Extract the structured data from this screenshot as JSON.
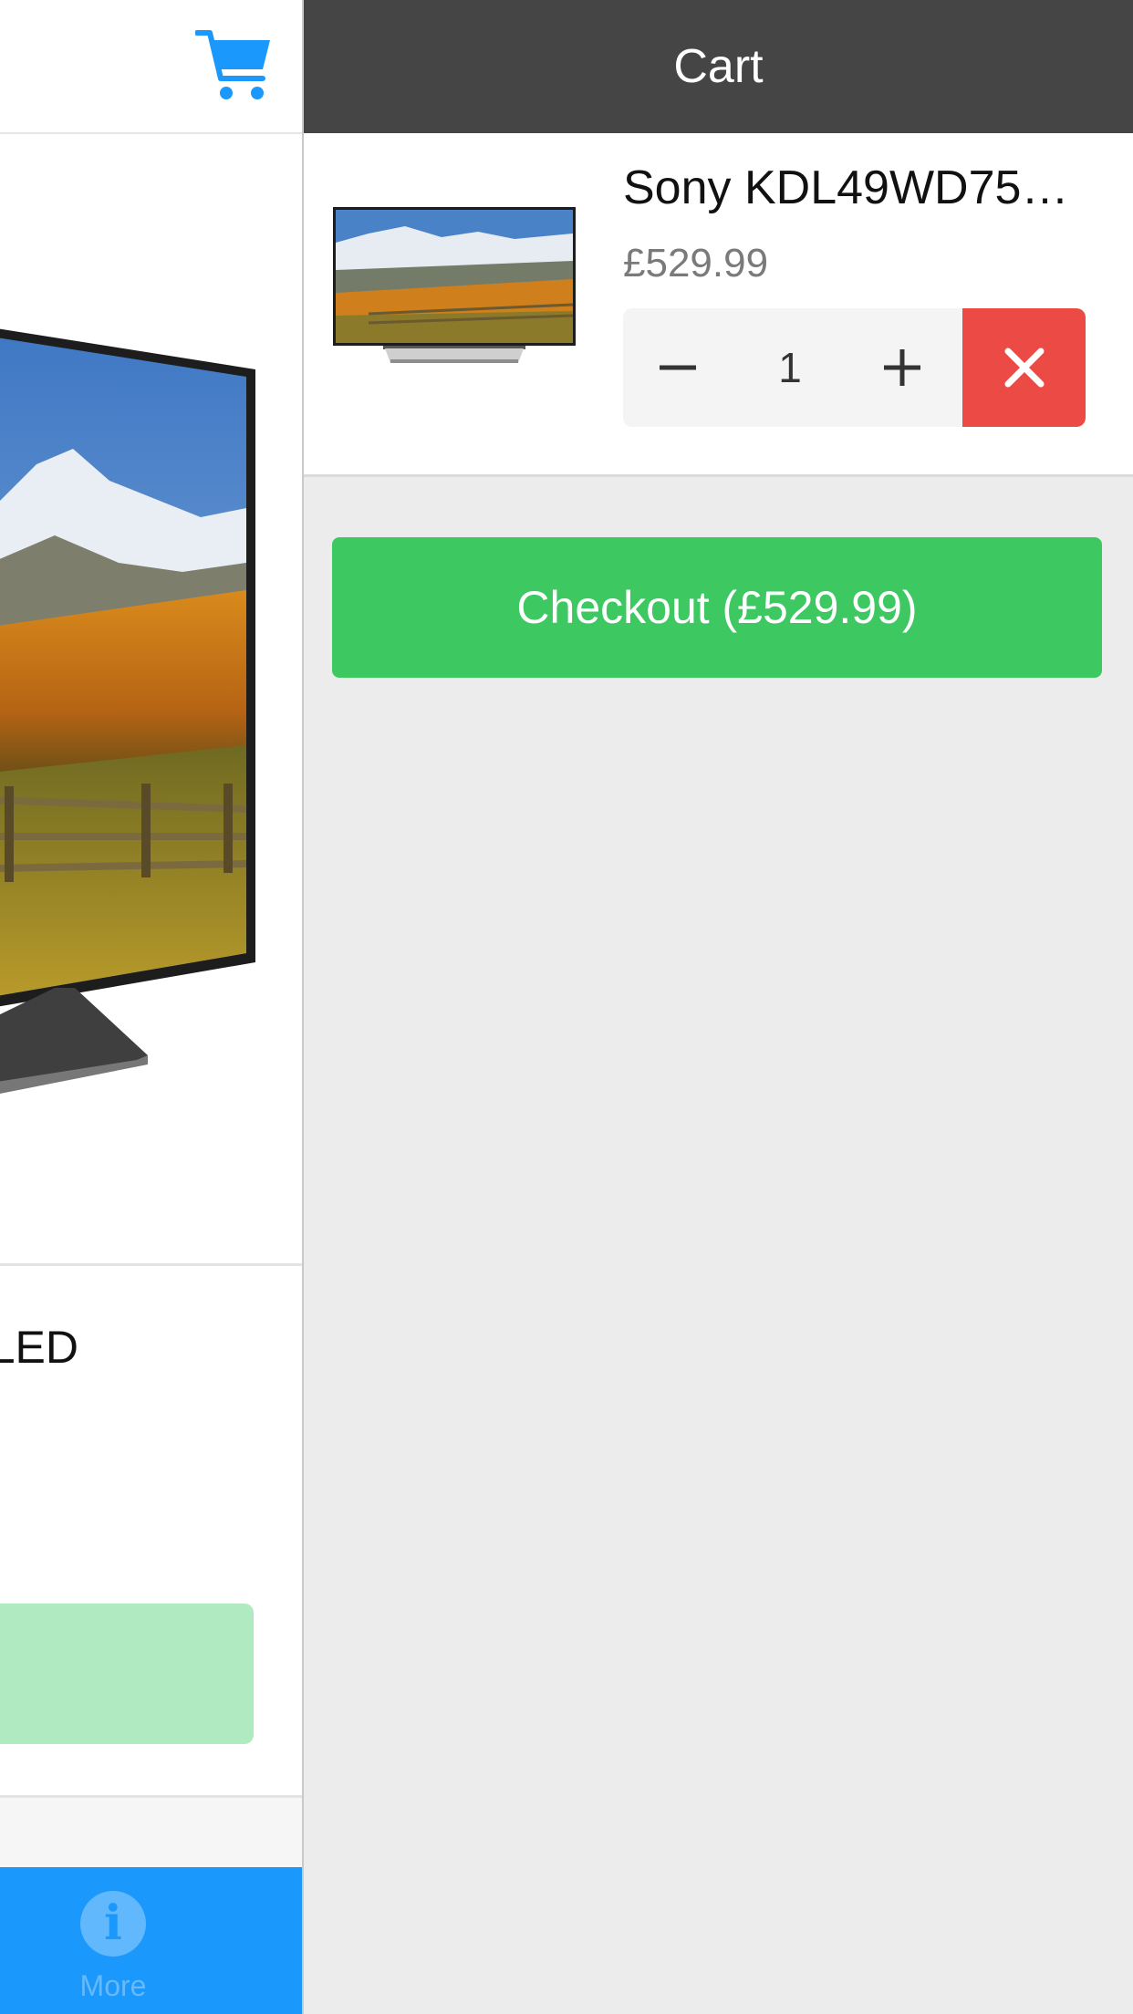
{
  "product_page": {
    "title_fragment": "LED",
    "tab_bar": {
      "more_label": "More",
      "more_icon": "info-icon"
    }
  },
  "cart": {
    "header_title": "Cart",
    "item": {
      "name": "Sony KDL49WD75…",
      "price": "£529.99",
      "quantity": "1",
      "decrement_icon": "minus-icon",
      "increment_icon": "plus-icon",
      "remove_icon": "close-icon"
    },
    "checkout_label": "Checkout (£529.99)"
  },
  "colors": {
    "cart_header": "#454545",
    "remove_red": "#ec4a44",
    "checkout_green": "#3ec862",
    "tab_bar_blue": "#1b98fb",
    "cart_icon_blue": "#1b98fb"
  }
}
